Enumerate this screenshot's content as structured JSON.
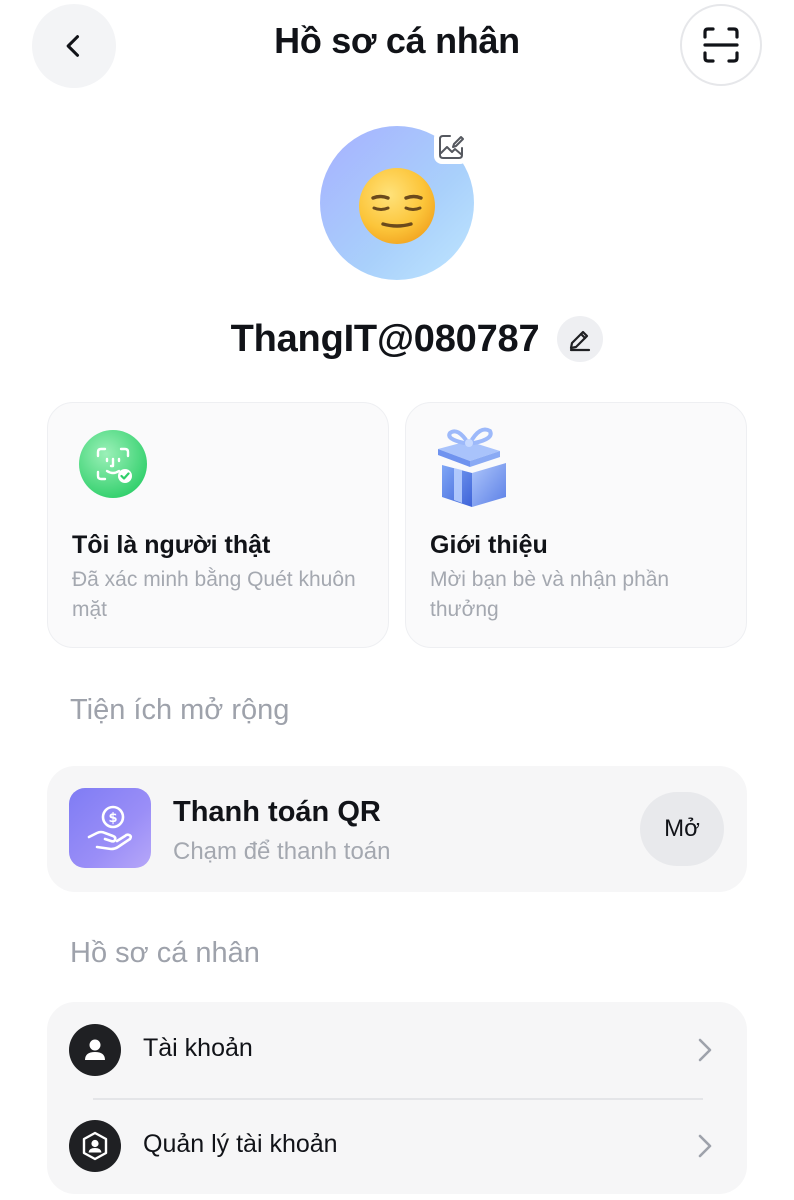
{
  "header": {
    "title": "Hồ sơ cá nhân",
    "back_icon": "chevron-left-icon",
    "scan_icon": "scan-frame-icon"
  },
  "profile": {
    "avatar_icon": "expressionless-face-emoji",
    "avatar_edit_icon": "image-edit-icon",
    "username": "ThangIT@080787",
    "edit_icon": "pencil-icon"
  },
  "cards": [
    {
      "title": "Tôi là người thật",
      "description": "Đã xác minh bằng Quét khuôn mặt",
      "icon": "face-id-verified-icon",
      "accent": "#2ecc71"
    },
    {
      "title": "Giới thiệu",
      "description": "Mời bạn bè và nhận phần thưởng",
      "icon": "gift-box-icon",
      "accent": "#4f7bf0"
    }
  ],
  "extensions": {
    "section_title": "Tiện ích mở rộng",
    "items": [
      {
        "title": "Thanh toán QR",
        "subtitle": "Chạm để thanh toán",
        "action_label": "Mở",
        "icon": "hand-coin-icon",
        "accent": "#8a83f6"
      }
    ]
  },
  "profile_section": {
    "section_title": "Hồ sơ cá nhân",
    "items": [
      {
        "label": "Tài khoản",
        "icon": "person-icon"
      },
      {
        "label": "Quản lý tài khoản",
        "icon": "shield-person-icon"
      }
    ]
  },
  "colors": {
    "text_primary": "#111318",
    "text_muted": "#a4a8b0",
    "panel_bg": "#f6f6f7"
  }
}
